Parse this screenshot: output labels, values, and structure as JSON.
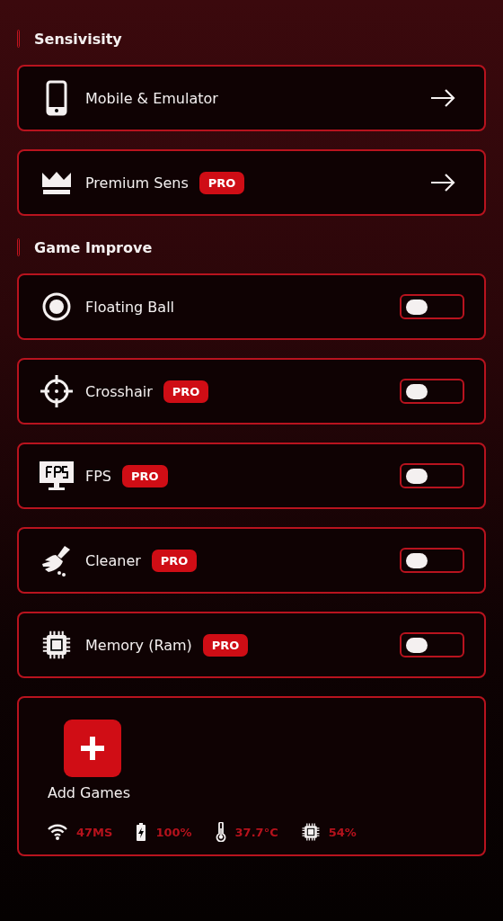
{
  "sections": [
    {
      "title": "Sensivisity",
      "items": [
        {
          "kind": "link",
          "label": "Mobile & Emulator"
        },
        {
          "kind": "link",
          "label": "Premium Sens",
          "badge": "PRO"
        }
      ]
    },
    {
      "title": "Game Improve",
      "items": [
        {
          "kind": "toggle",
          "label": "Floating Ball",
          "on": false
        },
        {
          "kind": "toggle",
          "label": "Crosshair",
          "badge": "PRO",
          "on": false
        },
        {
          "kind": "toggle",
          "label": "FPS",
          "badge": "PRO",
          "on": false
        },
        {
          "kind": "toggle",
          "label": "Cleaner",
          "badge": "PRO",
          "on": false
        },
        {
          "kind": "toggle",
          "label": "Memory (Ram)",
          "badge": "PRO",
          "on": false
        }
      ]
    }
  ],
  "games": {
    "add_label": "Add Games",
    "stats": [
      {
        "kind": "wifi",
        "value": "47MS"
      },
      {
        "kind": "battery",
        "value": "100%"
      },
      {
        "kind": "thermometer",
        "value": "37.7°C"
      },
      {
        "kind": "chip",
        "value": "54%"
      }
    ]
  }
}
